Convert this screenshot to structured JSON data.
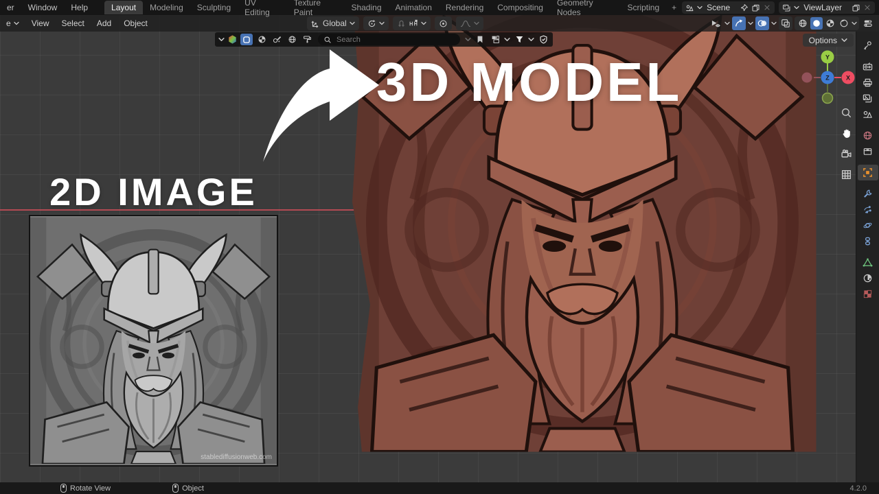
{
  "topbar": {
    "menus": [
      {
        "label": "er"
      },
      {
        "label": "Window"
      },
      {
        "label": "Help"
      }
    ],
    "workspaces": [
      {
        "label": "Layout"
      },
      {
        "label": "Modeling"
      },
      {
        "label": "Sculpting"
      },
      {
        "label": "UV Editing"
      },
      {
        "label": "Texture Paint"
      },
      {
        "label": "Shading"
      },
      {
        "label": "Animation"
      },
      {
        "label": "Rendering"
      },
      {
        "label": "Compositing"
      },
      {
        "label": "Geometry Nodes"
      },
      {
        "label": "Scripting"
      }
    ],
    "active_workspace": "Layout",
    "add_workspace_label": "+",
    "scene_selector": {
      "label": "Scene"
    },
    "viewlayer_selector": {
      "label": "ViewLayer"
    }
  },
  "viewport_header": {
    "mode_partial_label": "e",
    "menus": [
      {
        "label": "View"
      },
      {
        "label": "Select"
      },
      {
        "label": "Add"
      },
      {
        "label": "Object"
      }
    ],
    "transform_orientation": "Global",
    "left_icons": [
      "transform-orientation",
      "pivot-point",
      "snap-magnet",
      "snap-target",
      "proportional-editing",
      "falloff-curve"
    ],
    "right_icons": [
      "object-type-visibility",
      "show-gizmos",
      "show-overlays",
      "toggle-xray",
      "shading-wireframe",
      "shading-solid",
      "shading-material-preview",
      "shading-rendered",
      "editor-options"
    ]
  },
  "float_toolbar": {
    "search": {
      "placeholder": "Search"
    },
    "left_icons": [
      "collapse-chevron",
      "color-hexagon",
      "display-square",
      "display-pie-sphere",
      "display-pen",
      "display-globe",
      "display-paint"
    ],
    "right_icons": [
      "chevron",
      "bookmark",
      "window-stack",
      "filter-funnel",
      "shield-check"
    ]
  },
  "viewport": {
    "options_button_label": "Options",
    "nav_gizmo": {
      "top_axis": "Y",
      "center_axis": "Z",
      "right_axis": "X"
    },
    "axis_colors": {
      "x": "#ef4d62",
      "y": "#9acd45",
      "z": "#3e7cd6",
      "x_neg": "#93525a",
      "y_neg": "#5f7036"
    },
    "side_tools": [
      "zoom",
      "pan-hand",
      "camera-view",
      "toggle-ortho-grid"
    ]
  },
  "properties_tabs": [
    "tool",
    "render",
    "output",
    "view-layer",
    "scene",
    "world",
    "collection",
    "object",
    "modifiers",
    "particles",
    "physics",
    "constraints",
    "object-data",
    "material",
    "texture"
  ],
  "properties_active_tab": "object",
  "overlay": {
    "left_caption": "2D IMAGE",
    "right_caption": "3D MODEL",
    "watermark": "stablediffusionweb.com"
  },
  "statusbar": {
    "hints": [
      {
        "label": "Rotate View"
      },
      {
        "label": "Object"
      }
    ],
    "version": "4.2.0"
  },
  "colors": {
    "accent_blue": "#4772b3",
    "object_orange": "#e8912d",
    "axis_line_red": "#c94d58"
  }
}
